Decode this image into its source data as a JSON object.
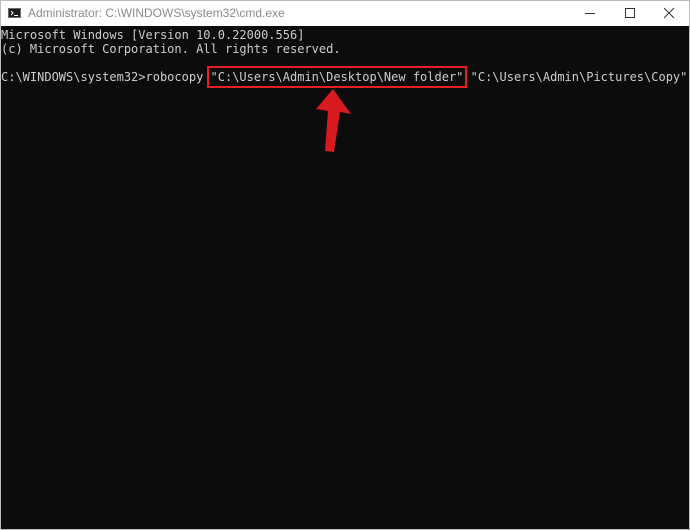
{
  "window": {
    "title": "Administrator: C:\\WINDOWS\\system32\\cmd.exe",
    "icon": "cmd-icon"
  },
  "console": {
    "line1": "Microsoft Windows [Version 10.0.22000.556]",
    "line2": "(c) Microsoft Corporation. All rights reserved.",
    "prompt": "C:\\WINDOWS\\system32>",
    "command": "robocopy ",
    "source_arg": "\"C:\\Users\\Admin\\Desktop\\New folder\"",
    "dest_arg": " \"C:\\Users\\Admin\\Pictures\\Copy\""
  },
  "colors": {
    "background": "#0c0c0c",
    "text": "#cccccc",
    "highlight": "#e81e25"
  }
}
